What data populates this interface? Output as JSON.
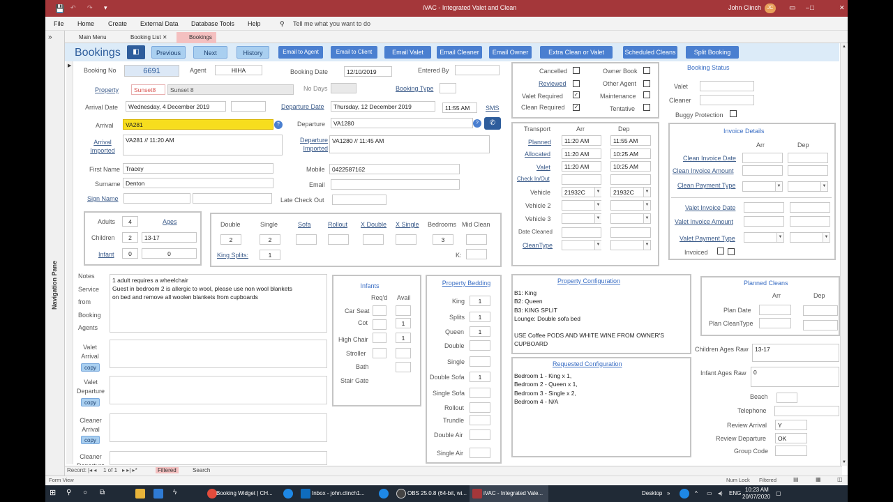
{
  "window": {
    "title": "iVAC - Integrated Valet and Clean",
    "user": "John Clinch",
    "user_initials": "JC",
    "min": "–",
    "max": "□",
    "close": "✕"
  },
  "ribbon": {
    "file": "File",
    "home": "Home",
    "create": "Create",
    "external": "External Data",
    "dbtools": "Database Tools",
    "help": "Help",
    "tellme": "Tell me what you want to do"
  },
  "nav": {
    "label": "Navigation Pane",
    "toggle": "»"
  },
  "tabs": {
    "main": "Main Menu",
    "list": "Booking List",
    "bookings": "Bookings"
  },
  "header": {
    "title": "Bookings",
    "previous": "Previous",
    "next": "Next",
    "history": "History",
    "email_agent": "Email to Agent",
    "email_client": "Email to Client",
    "email_valet": "Email Valet",
    "email_cleaner": "Email Cleaner",
    "email_owner": "Email Owner",
    "extra": "Extra Clean or Valet",
    "scheduled": "Scheduled Cleans",
    "split": "Split Booking"
  },
  "booking": {
    "no_label": "Booking No",
    "no": "6691",
    "agent_label": "Agent",
    "agent": "HIHA",
    "date_label": "Booking Date",
    "date": "12/10/2019",
    "entered_label": "Entered By",
    "entered": "",
    "property_label": "Property",
    "property_code": "Sunset8",
    "property_name": "Sunset 8",
    "nodays_label": "No Days",
    "nodays": "",
    "type_label": "Booking Type",
    "type": "",
    "arrival_date_label": "Arrival Date",
    "arrival_date": "Wednesday, 4 December 2019",
    "departure_date_label": "Departure Date",
    "departure_date": "Thursday, 12 December 2019",
    "departure_time": "11:55 AM",
    "sms": "SMS",
    "arrival_label": "Arrival",
    "arrival": "VA281",
    "departure_label": "Departure",
    "departure": "VA1280",
    "arrival_imported_label": "Arrival Imported",
    "arrival_imported": "VA281 // 11:20 AM",
    "departure_imported_label": "Departure Imported",
    "departure_imported": "VA1280 // 11:45 AM",
    "firstname_label": "First Name",
    "firstname": "Tracey",
    "mobile_label": "Mobile",
    "mobile": "0422587162",
    "surname_label": "Surname",
    "surname": "Denton",
    "email_label": "Email",
    "email": "",
    "signname_label": "Sign Name",
    "latecheckout_label": "Late Check Out"
  },
  "guests": {
    "adults_label": "Adults",
    "adults": "4",
    "ages_label": "Ages",
    "children_label": "Children",
    "children": "2",
    "children_ages": "13-17",
    "infant_label": "Infant",
    "infant": "0",
    "infant_ages": "0"
  },
  "beds": {
    "double_label": "Double",
    "double": "2",
    "single_label": "Single",
    "single": "2",
    "sofa_label": "Sofa",
    "rollout_label": "Rollout",
    "xdouble_label": "X Double",
    "xsingle_label": "X Single",
    "bedrooms_label": "Bedrooms",
    "bedrooms": "3",
    "midclean_label": "Mid Clean",
    "kingsplits_label": "King Splits:",
    "kingsplits": "1",
    "k_label": "K:"
  },
  "notes": {
    "label_lines": [
      "Notes",
      "Service",
      "from",
      "Booking",
      "Agents"
    ],
    "text": [
      "1 adult requires a wheelchair",
      "Guest in bedroom 2 is allergic to wool, please use non wool blankets",
      "on bed and remove all woolen blankets from cupboards"
    ],
    "valet_arrival": "Valet Arrival",
    "valet_departure": "Valet Departure",
    "cleaner_arrival": "Cleaner Arrival",
    "cleaner_departure": "Cleaner Departure",
    "copy": "copy"
  },
  "infants": {
    "title": "Infants",
    "reqd": "Req'd",
    "avail": "Avail",
    "carseat": "Car Seat",
    "cot": "Cot",
    "cot_avail": "1",
    "highchair": "High Chair",
    "highchair_avail": "1",
    "stroller": "Stroller",
    "bath": "Bath",
    "stairgate": "Stair Gate"
  },
  "bedding": {
    "title": "Property Bedding",
    "king": "King",
    "king_v": "1",
    "splits": "Splits",
    "splits_v": "1",
    "queen": "Queen",
    "queen_v": "1",
    "double": "Double",
    "single": "Single",
    "doublesofa": "Double Sofa",
    "doublesofa_v": "1",
    "singlesofa": "Single Sofa",
    "rollout": "Rollout",
    "trundle": "Trundle",
    "doubleair": "Double Air",
    "singleair": "Single Air"
  },
  "flags": {
    "cancelled": "Cancelled",
    "reviewed": "Reviewed",
    "valet_required": "Valet Required",
    "clean_required": "Clean Required",
    "owner_book": "Owner Book",
    "other_agent": "Other Agent",
    "maintenance": "Maintenance",
    "tentative": "Tentative",
    "check": "✓"
  },
  "transport": {
    "title": "Transport",
    "arr": "Arr",
    "dep": "Dep",
    "planned": "Planned",
    "planned_arr": "11:20 AM",
    "planned_dep": "11:55 AM",
    "allocated": "Allocated",
    "allocated_arr": "11:20 AM",
    "allocated_dep": "10:25 AM",
    "valet": "Valet",
    "valet_arr": "11:20 AM",
    "valet_dep": "10:25 AM",
    "checkinout": "Check In/Out",
    "vehicle": "Vehicle",
    "vehicle_arr": "21932C",
    "vehicle_dep": "21932C",
    "vehicle2": "Vehicle 2",
    "vehicle3": "Vehicle 3",
    "datecleaned": "Date Cleaned",
    "cleantype": "CleanType"
  },
  "status": {
    "title": "Booking Status",
    "valet": "Valet",
    "cleaner": "Cleaner",
    "buggy": "Buggy Protection"
  },
  "invoice": {
    "title": "Invoice Details",
    "arr": "Arr",
    "dep": "Dep",
    "clean_date": "Clean Invoice Date",
    "clean_amount": "Clean Invoice Amount",
    "clean_payment": "Clean Payment Type",
    "valet_date": "Valet Invoice Date",
    "valet_amount": "Valet Invoice Amount",
    "valet_payment": "Valet Payment Type",
    "invoiced": "Invoiced"
  },
  "propconfig": {
    "title": "Property Configuration",
    "lines": [
      "B1: King",
      "B2: Queen",
      "B3: KING SPLIT",
      "Lounge: Double sofa bed",
      "",
      "USE Coffee PODS AND WHITE WINE FROM OWNER'S",
      "CUPBOARD"
    ]
  },
  "reqconfig": {
    "title": "Requested Configuration",
    "lines": [
      "Bedroom 1 - King x 1,",
      "Bedroom 2 - Queen x 1,",
      "Bedroom 3 - Single x 2,",
      "Bedroom 4 - N/A"
    ]
  },
  "planned": {
    "title": "Planned Cleans",
    "arr": "Arr",
    "dep": "Dep",
    "date": "Plan Date",
    "cleantype": "Plan CleanType"
  },
  "extra": {
    "children_raw_label": "Children Ages Raw",
    "children_raw": "13-17",
    "infant_raw_label": "Infant Ages Raw",
    "infant_raw": "0",
    "beach": "Beach",
    "telephone": "Telephone",
    "review_arrival": "Review Arrival",
    "review_arrival_v": "Y",
    "review_departure": "Review Departure",
    "review_departure_v": "OK",
    "group_code": "Group Code"
  },
  "recnav": {
    "record": "Record:",
    "pos": "1 of 1",
    "filtered": "Filtered",
    "search": "Search"
  },
  "statusbar": {
    "view": "Form View",
    "numlock": "Num Lock",
    "filtered": "Filtered"
  },
  "taskbar": {
    "item1": "Booking Widget | CH...",
    "item2": "Inbox - john.clinch1...",
    "item3": "OBS 25.0.8 (64-bit, wi...",
    "item4": "iVAC - Integrated Vale...",
    "desktop": "Desktop",
    "lang": "ENG",
    "time": "10:23 AM",
    "date": "20/07/2020"
  }
}
